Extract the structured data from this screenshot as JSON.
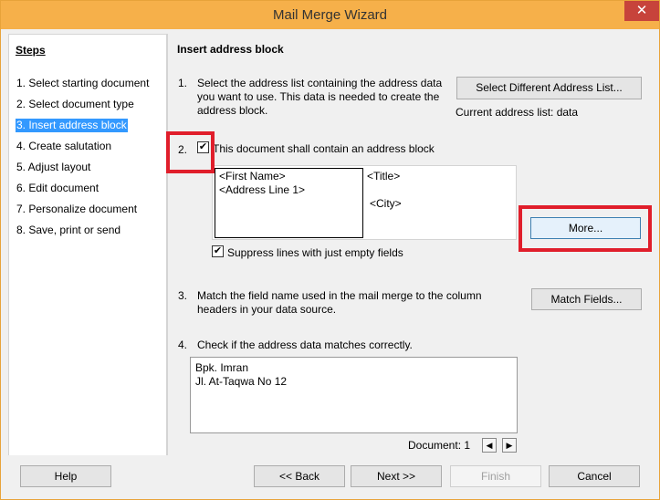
{
  "window": {
    "title": "Mail Merge Wizard",
    "close_glyph": "✕"
  },
  "steps": {
    "title": "Steps",
    "items": [
      {
        "label": "1. Select starting document"
      },
      {
        "label": "2. Select document type"
      },
      {
        "label": "3. Insert address block",
        "active": true
      },
      {
        "label": "4. Create salutation"
      },
      {
        "label": "5. Adjust layout"
      },
      {
        "label": "6. Edit document"
      },
      {
        "label": "7. Personalize document"
      },
      {
        "label": "8. Save, print or send"
      }
    ]
  },
  "main": {
    "heading": "Insert address block",
    "section1": {
      "number": "1.",
      "line1": "Select the address list containing the address data",
      "line2": "you want to use. This data is needed to create the",
      "line3": "address block.",
      "button": "Select Different Address List...",
      "current_list": "Current address list: data"
    },
    "section2": {
      "number": "2.",
      "checkbox_label": "This document shall contain an address block",
      "checked": true,
      "preview_a": [
        "<First Name>",
        "<Address Line 1>"
      ],
      "preview_b_title": "<Title>",
      "preview_b_city": "<City>",
      "more_button": "More...",
      "suppress_label": "Suppress lines with just empty fields",
      "suppress_checked": true
    },
    "section3": {
      "number": "3.",
      "line1": "Match the field name used in the mail merge to the column",
      "line2": "headers in your data source.",
      "button": "Match Fields..."
    },
    "section4": {
      "number": "4.",
      "line1": "Check if the address data matches correctly.",
      "data_lines": [
        "Bpk. Imran",
        "Jl. At-Taqwa No 12"
      ],
      "document_label": "Document: 1",
      "prev_glyph": "◀",
      "next_glyph": "▶"
    }
  },
  "footer": {
    "help": "Help",
    "back": "<< Back",
    "next": "Next >>",
    "finish": "Finish",
    "cancel": "Cancel"
  },
  "colors": {
    "highlight": "#e01e2b",
    "titlebar": "#f6b04a",
    "selection": "#3399ff"
  }
}
